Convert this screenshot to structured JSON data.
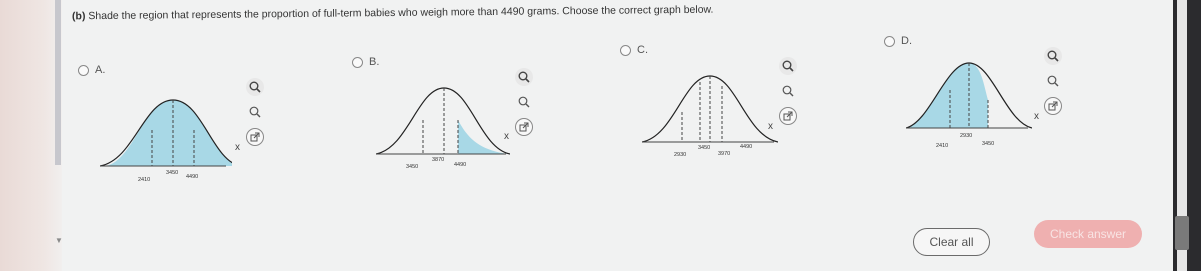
{
  "question": {
    "part": "(b)",
    "text": "Shade the region that represents the proportion of full-term babies who weigh more than 4490 grams. Choose the correct graph below."
  },
  "options": [
    {
      "id": "A",
      "label": "A.",
      "ticks": [
        "2410",
        "3450",
        "4490"
      ],
      "x_label": "x"
    },
    {
      "id": "B",
      "label": "B.",
      "ticks": [
        "3450",
        "3870",
        "4490"
      ],
      "x_label": "x"
    },
    {
      "id": "C",
      "label": "C.",
      "ticks": [
        "2930",
        "3450",
        "3970",
        "4490"
      ],
      "x_label": "x"
    },
    {
      "id": "D",
      "label": "D.",
      "ticks": [
        "2410",
        "2930",
        "3450"
      ],
      "x_label": "x"
    }
  ],
  "buttons": {
    "clear": "Clear all",
    "check": "Check answer"
  },
  "icons": [
    "zoom-in-icon",
    "zoom-out-icon",
    "external-link-icon",
    "radio-icon"
  ],
  "colors": {
    "shade": "#a8d8e6",
    "curve": "#222222",
    "check_button": "#efb0b0"
  }
}
